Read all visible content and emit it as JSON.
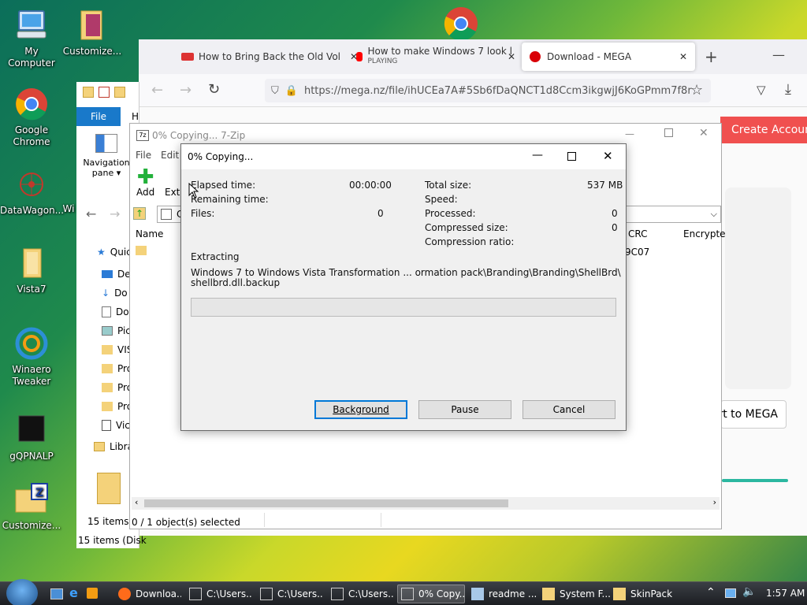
{
  "desktop": {
    "icons": [
      {
        "label": "My Computer",
        "icon": "computer-icon"
      },
      {
        "label": "Customize...",
        "icon": "folder-icon"
      },
      {
        "label": "Google Chrome",
        "icon": "chrome-icon"
      },
      {
        "label": "DataWagon...",
        "icon": "network-icon"
      },
      {
        "label": "Vista7",
        "icon": "folder-icon"
      },
      {
        "label": "Winaero Tweaker",
        "icon": "winaero-icon"
      },
      {
        "label": "gQPNALP",
        "icon": "black-file-icon"
      },
      {
        "label": "Customize...",
        "icon": "folder-zip-icon"
      },
      {
        "label": "Wi",
        "icon": "partial-icon"
      }
    ]
  },
  "browser": {
    "tabs": [
      {
        "title": "How to Bring Back the Old Vol"
      },
      {
        "title": "How to make Windows 7 look l",
        "subtitle": "PLAYING"
      },
      {
        "title": "Download - MEGA"
      }
    ],
    "url": "https://mega.nz/file/ihUCEa7A#5Sb6fDaQNCT1d8Ccm3ikgwjJ6KoGPmm7f8r",
    "create_account": "Create Account",
    "mega_button": "rt to MEGA"
  },
  "explorer": {
    "file_tab": "File",
    "h_tab": "H",
    "nav_pane": "Navigation pane",
    "quick": "Quic",
    "sidebar": [
      "De",
      "Do",
      "Do",
      "Pic",
      "VIS",
      "Pro",
      "Pro",
      "Pro",
      "Vic",
      "Libra"
    ],
    "item_count": "15 items",
    "status": "15 items (Disk"
  },
  "zipmain": {
    "title": "0% Copying... 7-Zip",
    "menu": [
      "File",
      "Edit"
    ],
    "add_label": "Add",
    "extract_label": "Extr",
    "path_prefix": "C",
    "columns": {
      "name": "Name",
      "crc": "CRC",
      "encrypted": "Encrypte"
    },
    "crc_value": "9C07",
    "status": "0 / 1 object(s) selected"
  },
  "dialog": {
    "title": "0% Copying...",
    "elapsed_label": "Elapsed time:",
    "elapsed_value": "00:00:00",
    "remaining_label": "Remaining time:",
    "files_label": "Files:",
    "files_value": "0",
    "total_label": "Total size:",
    "total_value": "537 MB",
    "speed_label": "Speed:",
    "processed_label": "Processed:",
    "processed_value": "0",
    "compressed_label": "Compressed size:",
    "compressed_value": "0",
    "ratio_label": "Compression ratio:",
    "action": "Extracting",
    "path_line1": "Windows 7 to Windows Vista Transformation ... ormation pack\\Branding\\Branding\\ShellBrd\\",
    "path_line2": "shellbrd.dll.backup",
    "progress": 0,
    "buttons": {
      "background": "Background",
      "pause": "Pause",
      "cancel": "Cancel"
    }
  },
  "taskbar": {
    "items": [
      {
        "label": "Downloa...",
        "icon": "firefox-icon"
      },
      {
        "label": "C:\\Users...",
        "icon": "7zip-icon"
      },
      {
        "label": "C:\\Users...",
        "icon": "7zip-icon"
      },
      {
        "label": "C:\\Users...",
        "icon": "7zip-icon"
      },
      {
        "label": "0% Copy...",
        "icon": "7zip-icon"
      },
      {
        "label": "readme ...",
        "icon": "notepad-icon"
      },
      {
        "label": "System F...",
        "icon": "folder-icon"
      },
      {
        "label": "SkinPack",
        "icon": "folder-icon"
      }
    ],
    "time": "1:57 AM"
  }
}
